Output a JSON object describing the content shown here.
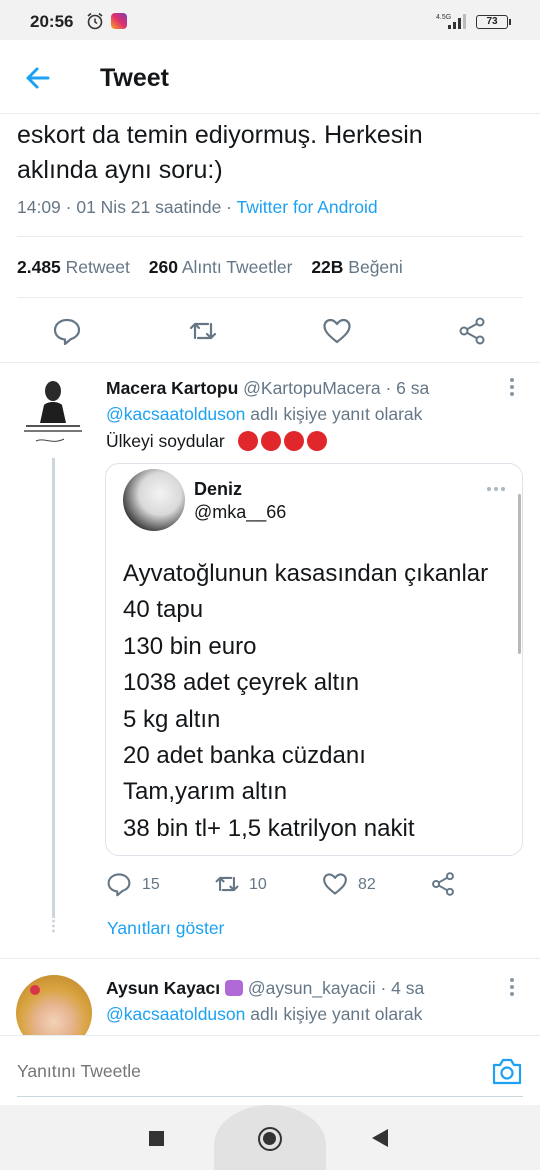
{
  "status_bar": {
    "time": "20:56",
    "network": "4.5G",
    "battery": "73"
  },
  "header": {
    "title": "Tweet"
  },
  "tweet": {
    "text_line1": "eskort da temin ediyormuş. Herkesin",
    "text_line2": "aklında aynı soru:)",
    "meta_time": "14:09 · 01 Nis 21 saatinde · ",
    "source": "Twitter for Android",
    "retweet_count": "2.485",
    "retweet_label": "Retweet",
    "quote_count": "260",
    "quote_label": "Alıntı Tweetler",
    "like_count": "22B",
    "like_label": "Beğeni"
  },
  "reply1": {
    "name": "Macera Kartopu",
    "handle": "@KartopuMacera",
    "time": "· 6 sa",
    "reply_to_user": "@kacsaatolduson",
    "reply_to_suffix": " adlı kişiye yanıt olarak",
    "text": "Ülkeyi soydular",
    "avatar_caption": "UYUNAN MİLLETLER YA ÖLÜR, YA DA KÖLE OLARAK UYANIR..!",
    "quoted": {
      "name": "Deniz",
      "handle": "@mka__66",
      "lines": [
        "Ayvatoğlunun kasasından çıkanlar",
        "40 tapu",
        "130 bin euro",
        "1038 adet çeyrek altın",
        "5 kg altın",
        "20 adet banka cüzdanı",
        "Tam,yarım altın",
        "38 bin tl+ 1,5 katrilyon nakit"
      ]
    },
    "reply_count": "15",
    "retweet_count": "10",
    "like_count": "82",
    "show_replies": "Yanıtları göster"
  },
  "reply2": {
    "name": "Aysun Kayacı",
    "handle": "@aysun_kayacii",
    "time": "· 4 sa",
    "reply_to_user": "@kacsaatolduson",
    "reply_to_suffix": " adlı kişiye yanıt olarak"
  },
  "compose": {
    "placeholder": "Yanıtını Tweetle"
  },
  "colors": {
    "accent": "#1da1f2",
    "secondary_text": "#657786",
    "text": "#14171a",
    "divider": "#e6ecf0"
  },
  "icons": [
    "alarm-icon",
    "instagram-icon",
    "signal-icon",
    "battery-icon",
    "back-arrow-icon",
    "reply-icon",
    "retweet-icon",
    "like-icon",
    "share-icon",
    "more-icon",
    "camera-icon",
    "angry-emoji-icon"
  ]
}
